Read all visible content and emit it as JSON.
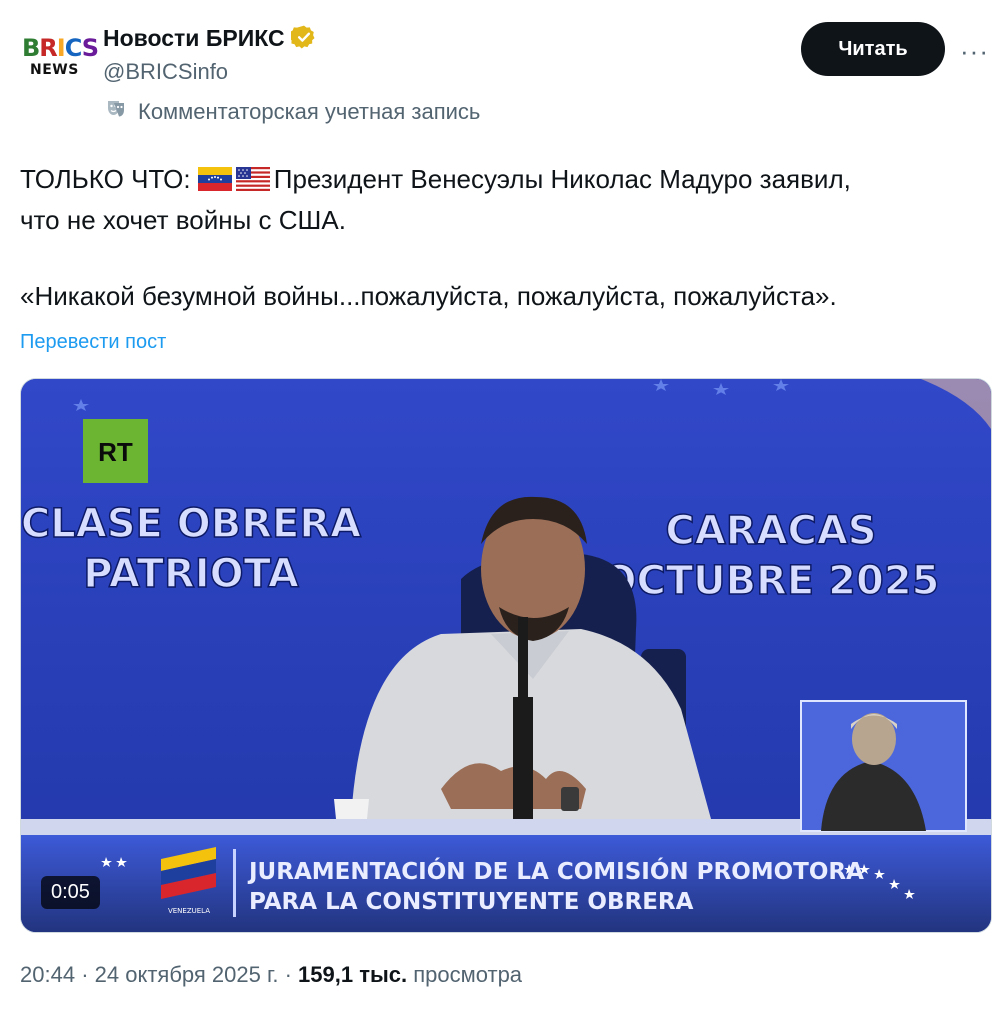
{
  "account": {
    "avatar_line1": "BRICS",
    "avatar_line2": "NEWS",
    "name": "Новости БРИКС",
    "handle": "@BRICSinfo",
    "follow_label": "Читать",
    "more_label": "···",
    "account_label": "Комментаторская учетная запись"
  },
  "post": {
    "prefix": "ТОЛЬКО ЧТО: ",
    "line1": "Президент Венесуэлы Николас Мадуро заявил,",
    "line2": "что не хочет войны с США.",
    "quote": "«Никакой безумной войны...пожалуйста, пожалуйста, пожалуйста».",
    "translate_label": "Перевести пост",
    "flags": [
      "venezuela-flag-icon",
      "usa-flag-icon"
    ]
  },
  "video": {
    "channel_logo": "RT",
    "left_caption_1": "CLASE OBRERA",
    "left_caption_2": "PATRIOTA",
    "right_caption_1": "CARACAS",
    "right_caption_2": "OCTUBRE 2025",
    "lower_third_1": "JURAMENTACIÓN DE LA COMISIÓN PROMOTORA",
    "lower_third_2": "PARA LA CONSTITUYENTE OBRERA",
    "emblem_text": "VENEZUELA",
    "duration": "0:05"
  },
  "meta": {
    "time": "20:44",
    "date": "24 октября 2025 г.",
    "views_count": "159,1 тыс.",
    "views_label": "просмотра"
  },
  "colors": {
    "verified": "#e2b719",
    "link": "#1d9bf0",
    "video_bg": "#2a44b8",
    "rt_green": "#6cb532"
  }
}
